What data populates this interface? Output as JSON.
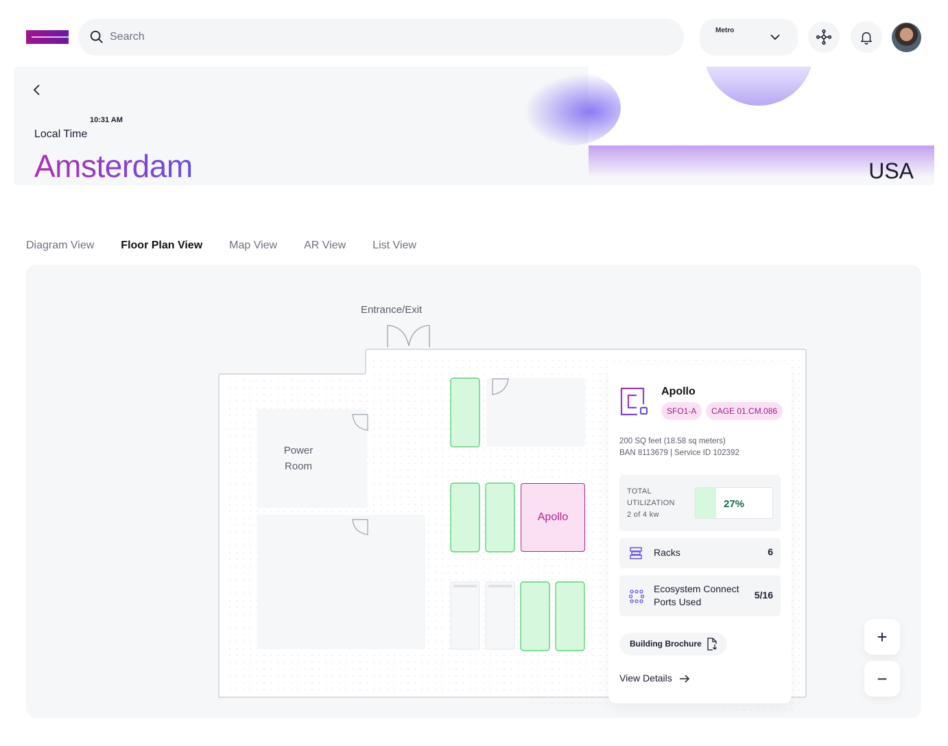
{
  "header": {
    "search_placeholder": "Search",
    "metro_label": "Metro"
  },
  "hero": {
    "time": "10:31 AM",
    "local_label": "Local Time",
    "city": "Amsterdam",
    "country": "USA"
  },
  "tabs": [
    {
      "label": "Diagram View",
      "active": false
    },
    {
      "label": "Floor Plan View",
      "active": true
    },
    {
      "label": "Map View",
      "active": false
    },
    {
      "label": "AR View",
      "active": false
    },
    {
      "label": "List View",
      "active": false
    }
  ],
  "floorplan": {
    "entrance_label": "Entrance/Exit",
    "power_room_line1": "Power",
    "power_room_line2": "Room",
    "selected_rack": "Apollo"
  },
  "panel": {
    "title": "Apollo",
    "tag1": "SFO1-A",
    "tag2": "CAGE 01.CM.086",
    "area": "200 SQ feet (18.58 sq meters)",
    "ids": "BAN 8113679  |  Service ID 102392",
    "utilization": {
      "line1": "TOTAL",
      "line2": "UTILIZATION",
      "line3": "2 of 4 kw",
      "percent_label": "27%",
      "percent": 0.27
    },
    "racks_label": "Racks",
    "racks_value": "6",
    "ports_line1": "Ecosystem Connect",
    "ports_line2": "Ports Used",
    "ports_value": "5/16",
    "brochure_label": "Building Brochure",
    "details_label": "View Details"
  },
  "zoom": {
    "in": "+",
    "out": "−"
  },
  "colors": {
    "accent_magenta": "#b0238a",
    "accent_purple": "#6a50e0",
    "rack_green_fill": "#d6f9dd",
    "rack_green_stroke": "#5fcf7c",
    "pill_bg": "#fbe0f4"
  }
}
